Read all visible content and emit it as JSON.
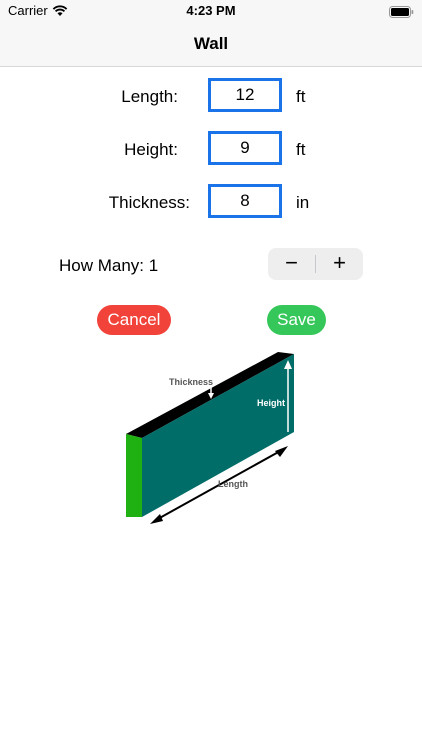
{
  "status_bar": {
    "carrier": "Carrier",
    "time": "4:23 PM"
  },
  "nav": {
    "title": "Wall"
  },
  "fields": {
    "length": {
      "label": "Length:",
      "value": "12",
      "unit": "ft"
    },
    "height": {
      "label": "Height:",
      "value": "9",
      "unit": "ft"
    },
    "thickness": {
      "label": "Thickness:",
      "value": "8",
      "unit": "in"
    }
  },
  "how_many": {
    "label": "How Many: 1",
    "minus": "−",
    "plus": "+"
  },
  "buttons": {
    "cancel": "Cancel",
    "save": "Save"
  },
  "diagram": {
    "thickness_label": "Thickness",
    "height_label": "Height",
    "length_label": "Length"
  },
  "colors": {
    "accent": "#1a73e8",
    "cancel": "#f2433a",
    "save": "#35c759",
    "wall_face": "#006d68",
    "wall_side": "#1fb012"
  }
}
